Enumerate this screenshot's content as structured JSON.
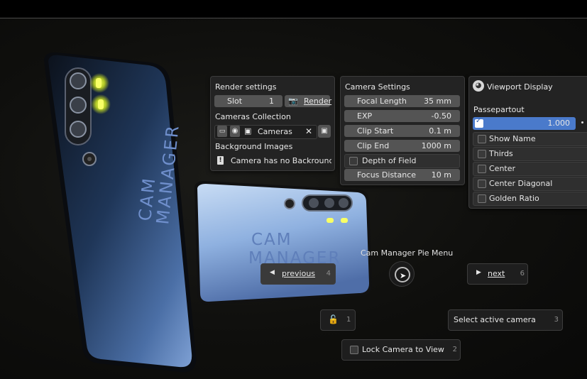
{
  "render_settings": {
    "title": "Render settings",
    "slot_label": "Slot",
    "slot_value": "1",
    "render_button": "Render",
    "collection_heading": "Cameras Collection",
    "collection_name": "Cameras",
    "background_heading": "Background Images",
    "background_message": "Camera has no Backround I..."
  },
  "camera_settings": {
    "title": "Camera Settings",
    "rows": [
      {
        "label": "Focal Length",
        "value": "35 mm"
      },
      {
        "label": "EXP",
        "value": "-0.50"
      },
      {
        "label": "Clip Start",
        "value": "0.1 m"
      },
      {
        "label": "Clip End",
        "value": "1000 m"
      }
    ],
    "dof_label": "Depth of Field",
    "focus_label": "Focus Distance",
    "focus_value": "10 m"
  },
  "viewport_display": {
    "title": "Viewport Display",
    "passepartout_label": "Passepartout",
    "passepartout_value": "1.000",
    "options": [
      "Show Name",
      "Thirds",
      "Center",
      "Center Diagonal",
      "Golden Ratio"
    ]
  },
  "pie_menu": {
    "title": "Cam Manager Pie Menu",
    "previous": {
      "label": "previous",
      "key": "4"
    },
    "next": {
      "label": "next",
      "key": "6"
    },
    "lock": {
      "key": "1"
    },
    "select_active": {
      "label": "Select active camera",
      "key": "3"
    },
    "lock_camera": {
      "label": "Lock Camera to View",
      "key": "2"
    }
  },
  "phone_text": {
    "line1": "CAM",
    "line2": "MANAGER"
  },
  "colors": {
    "accent_blue": "#4a7acb",
    "phone_blue": "#5d86c4",
    "led_yellow": "#f3ff3a"
  }
}
